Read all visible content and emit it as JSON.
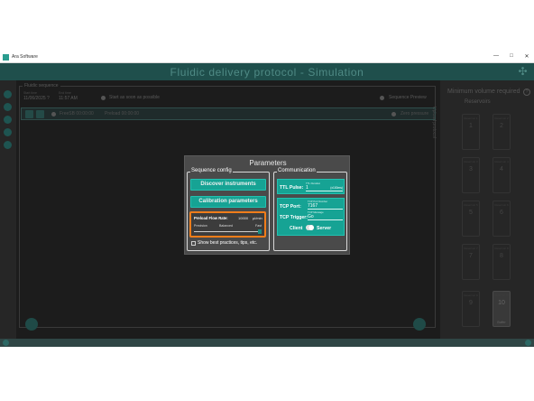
{
  "window": {
    "app_title": "Ara Software",
    "minimize": "—",
    "maximize": "□",
    "close": "✕"
  },
  "header": {
    "title": "Fluidic delivery protocol - Simulation",
    "icon": "fluidic-network-icon"
  },
  "sequence_panel": {
    "label": "Fluidic sequence",
    "start_label": "Start time",
    "start_date": "11/06/2025 ?",
    "end_label": "End time",
    "end_time": "11:57 AM",
    "start_asap": "Start as soon as possible",
    "sequence_preview": "Sequence Preview",
    "row": {
      "index": "1",
      "step1": "FreeSB 00:00:00",
      "step2": "Preload 00:00:00",
      "status": "Zero pressure"
    }
  },
  "right_panel": {
    "protocol_label": "Upload protocol",
    "min_volume": "Minimum volume required",
    "help": "?",
    "reservoirs_title": "Reservoirs",
    "reservoirs": [
      {
        "label": "Reservoir 1",
        "num": "1"
      },
      {
        "label": "Reservoir 2",
        "num": "2"
      },
      {
        "label": "Reservoir 3",
        "num": "3"
      },
      {
        "label": "Reservoir 4",
        "num": "4"
      },
      {
        "label": "Reservoir 5",
        "num": "5"
      },
      {
        "label": "Reservoir 6",
        "num": "6"
      },
      {
        "label": "Reservoir 7",
        "num": "7"
      },
      {
        "label": "Reservoir 8",
        "num": "8"
      },
      {
        "label": "Reservoir 9",
        "num": "9"
      },
      {
        "label": "Reservoir 10",
        "num": "10",
        "buffer": "Buffer"
      }
    ]
  },
  "dialog": {
    "title": "Parameters",
    "sequence_config": {
      "label": "Sequence config",
      "discover": "Discover instruments",
      "calibration": "Calibration parameters",
      "flow_rate_label": "Preload Flow Rate:",
      "flow_rate_value": "10000",
      "flow_rate_unit": "µl/min",
      "preset_precision": "Precision",
      "preset_balanced": "Balanced",
      "preset_fast": "Fast",
      "flow_rate_level": 1.0,
      "show_best_practices": "Show best practices, tips, etc."
    },
    "communication": {
      "label": "Communication",
      "ttl_label": "TTL Pulse:",
      "ttl_field_label": "TTL Duration",
      "ttl_value": "1",
      "ttl_unit": "(x100ms)",
      "tcp_port_label": "TCP Port:",
      "tcp_port_field_label": "TCP Port Number",
      "tcp_port_value": "7167",
      "tcp_trigger_label": "TCP Trigger:",
      "tcp_trigger_field_label": "TCP Message",
      "tcp_trigger_value": "Go",
      "client": "Client",
      "server": "Server"
    }
  },
  "colors": {
    "accent": "#16a394",
    "highlight": "#f07d1a",
    "header_bg": "#1f4f4c",
    "dialog_bg": "#4a4a4a"
  }
}
